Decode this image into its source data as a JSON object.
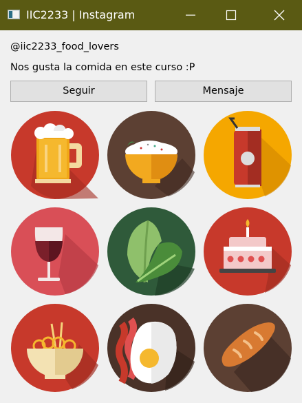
{
  "window": {
    "title": "IIC2233 | Instagram"
  },
  "profile": {
    "handle": "@iic2233_food_lovers",
    "bio": "Nos gusta la comida en este curso :P"
  },
  "actions": {
    "follow_label": "Seguir",
    "message_label": "Mensaje"
  },
  "colors": {
    "titlebar": "#5a5a13",
    "button_bg": "#e1e1e1",
    "window_bg": "#f0f0f0"
  },
  "posts": [
    {
      "icon": "beer-mug-icon",
      "background": "#c7392b"
    },
    {
      "icon": "rice-bowl-icon",
      "background": "#5c4033"
    },
    {
      "icon": "soda-can-icon",
      "background": "#f5a700"
    },
    {
      "icon": "wine-glass-icon",
      "background": "#d94f57"
    },
    {
      "icon": "lettuce-icon",
      "background": "#2f5a3a"
    },
    {
      "icon": "birthday-cake-icon",
      "background": "#c7392b"
    },
    {
      "icon": "noodles-bowl-icon",
      "background": "#c7392b"
    },
    {
      "icon": "egg-bacon-icon",
      "background": "#4a3228"
    },
    {
      "icon": "bread-icon",
      "background": "#5c4033"
    }
  ]
}
